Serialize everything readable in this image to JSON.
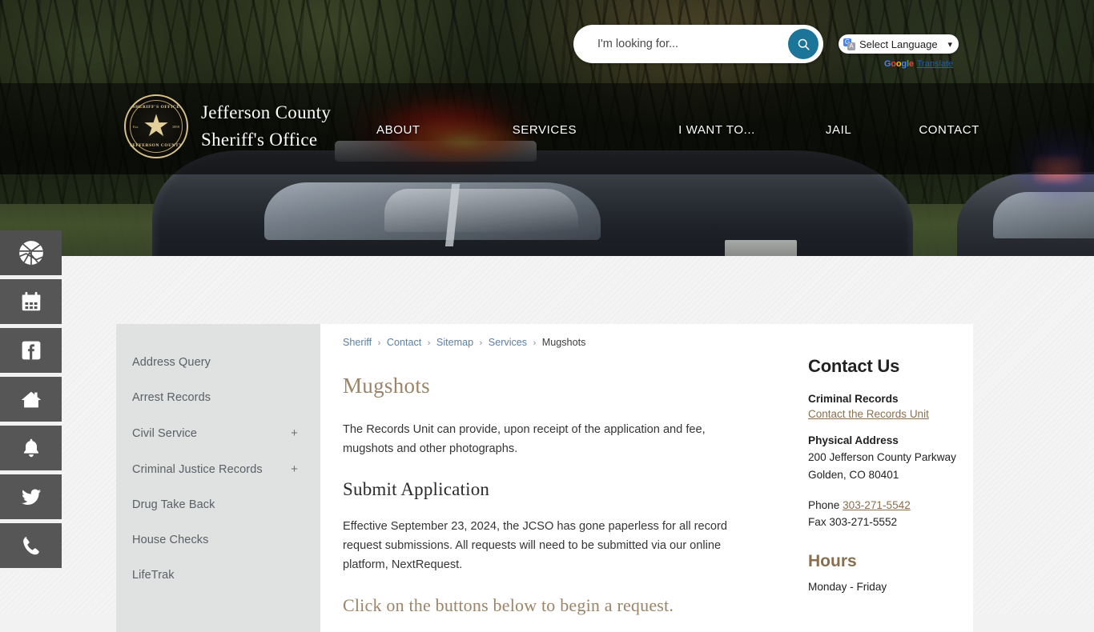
{
  "header": {
    "search": {
      "placeholder": "I'm looking for...",
      "value": "",
      "button_icon": "search-icon"
    },
    "translate": {
      "label": "Select Language",
      "chevron": "▾",
      "credit_google": "Google",
      "credit_link": "Translate"
    },
    "brand": {
      "line1": "Jefferson County",
      "line2": "Sheriff's Office",
      "seal_top": "SHERIFF'S OFFICE",
      "seal_bottom": "JEFFERSON COUNTY",
      "seal_est_left": "Est.",
      "seal_est_right": "1859",
      "seal_star": "★"
    },
    "nav": [
      {
        "label": "ABOUT"
      },
      {
        "label": "SERVICES"
      },
      {
        "label": "I WANT TO..."
      },
      {
        "label": "JAIL"
      },
      {
        "label": "CONTACT"
      }
    ]
  },
  "social_rail": [
    {
      "icon": "map-icon",
      "name": "map"
    },
    {
      "icon": "calendar-icon",
      "name": "calendar"
    },
    {
      "icon": "facebook-icon",
      "name": "facebook"
    },
    {
      "icon": "house-icon",
      "name": "house"
    },
    {
      "icon": "bell-icon",
      "name": "notify"
    },
    {
      "icon": "twitter-icon",
      "name": "twitter"
    },
    {
      "icon": "phone-icon",
      "name": "phone"
    }
  ],
  "left_menu": [
    {
      "label": "Address Query",
      "expand": ""
    },
    {
      "label": "Arrest Records",
      "expand": ""
    },
    {
      "label": "Civil Service",
      "expand": "+"
    },
    {
      "label": "Criminal Justice Records",
      "expand": "+"
    },
    {
      "label": "Drug Take Back",
      "expand": ""
    },
    {
      "label": "House Checks",
      "expand": ""
    },
    {
      "label": "LifeTrak",
      "expand": ""
    }
  ],
  "breadcrumb": {
    "items": [
      {
        "label": "Sheriff",
        "link": true
      },
      {
        "label": "Contact",
        "link": true
      },
      {
        "label": "Sitemap",
        "link": true
      },
      {
        "label": "Services",
        "link": true
      },
      {
        "label": "Mugshots",
        "link": false
      }
    ],
    "separator": "›"
  },
  "main": {
    "title": "Mugshots",
    "paragraph_1": "The Records Unit can provide, upon receipt of the application and fee, mugshots and other photographs.",
    "heading_2": "Submit Application",
    "paragraph_2": "Effective September 23, 2024, the JCSO has gone paperless for all record request submissions. All requests will need to be submitted via our online platform, NextRequest.",
    "heading_3_partial": "Click on the buttons below to begin a request."
  },
  "contact_panel": {
    "title": "Contact Us",
    "criminal_records_label": "Criminal Records",
    "records_unit_link": "Contact the Records Unit",
    "physical_address_label": "Physical Address",
    "address_line_1": "200 Jefferson County Parkway",
    "address_line_2": "Golden, CO 80401",
    "phone_label": "Phone",
    "phone_number": "303-271-5542",
    "fax_line": "Fax 303-271-5552",
    "hours_title": "Hours",
    "hours_line_1": "Monday - Friday"
  },
  "colors": {
    "accent_teal": "#1a7599",
    "brand_gold": "#9c8468",
    "link_brown": "#8a6f4e",
    "breadcrumb_link": "#5c7fa5",
    "rail_gray": "#565656",
    "menu_bg": "#e0e1e1"
  }
}
